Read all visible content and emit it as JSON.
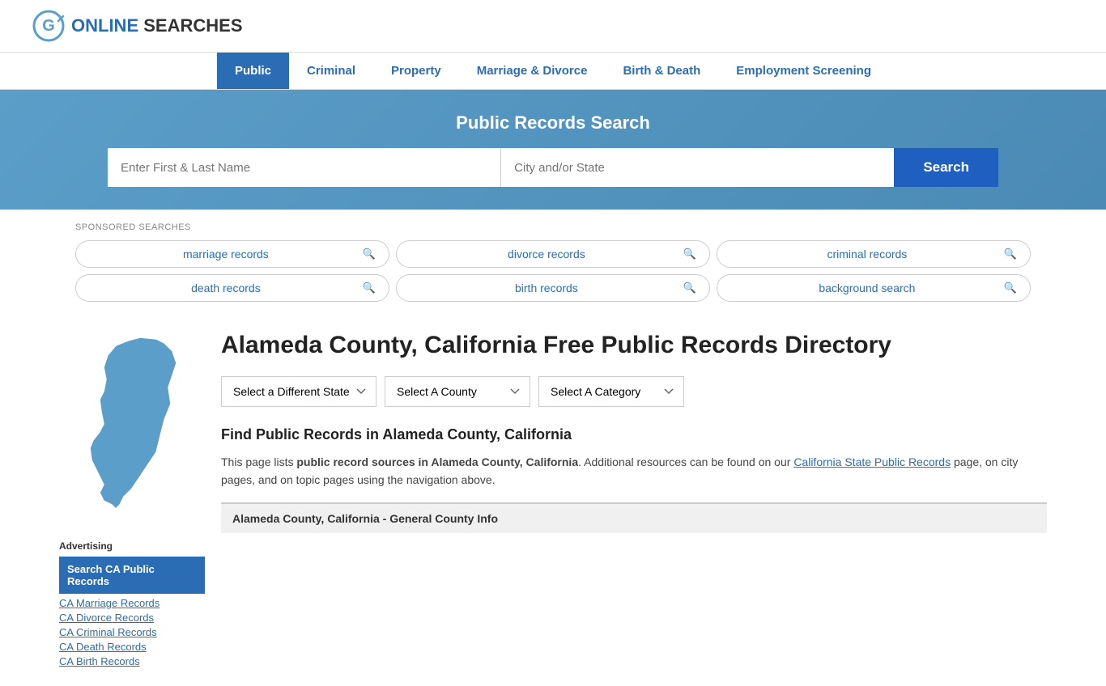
{
  "site": {
    "logo_text_normal": "ONLINE",
    "logo_text_bold": "SEARCHES"
  },
  "nav": {
    "items": [
      {
        "label": "Public",
        "active": true
      },
      {
        "label": "Criminal",
        "active": false
      },
      {
        "label": "Property",
        "active": false
      },
      {
        "label": "Marriage & Divorce",
        "active": false
      },
      {
        "label": "Birth & Death",
        "active": false
      },
      {
        "label": "Employment Screening",
        "active": false
      }
    ]
  },
  "search_banner": {
    "title": "Public Records Search",
    "name_placeholder": "Enter First & Last Name",
    "location_placeholder": "City and/or State",
    "button_label": "Search"
  },
  "sponsored": {
    "label": "SPONSORED SEARCHES",
    "items": [
      {
        "text": "marriage records"
      },
      {
        "text": "divorce records"
      },
      {
        "text": "criminal records"
      },
      {
        "text": "death records"
      },
      {
        "text": "birth records"
      },
      {
        "text": "background search"
      }
    ]
  },
  "page": {
    "title": "Alameda County, California Free Public Records Directory",
    "find_heading": "Find Public Records in Alameda County, California",
    "description_part1": "This page lists ",
    "description_bold": "public record sources in Alameda County, California",
    "description_part2": ". Additional resources can be found on our ",
    "description_link": "California State Public Records",
    "description_part3": " page, on city pages, and on topic pages using the navigation above.",
    "general_info": "Alameda County, California - General County Info"
  },
  "dropdowns": {
    "state": "Select a Different State",
    "county": "Select A County",
    "category": "Select A Category"
  },
  "sidebar": {
    "advertising_label": "Advertising",
    "featured_ad": "Search CA Public Records",
    "links": [
      "CA Marriage Records",
      "CA Divorce Records",
      "CA Criminal Records",
      "CA Death Records",
      "CA Birth Records"
    ]
  }
}
